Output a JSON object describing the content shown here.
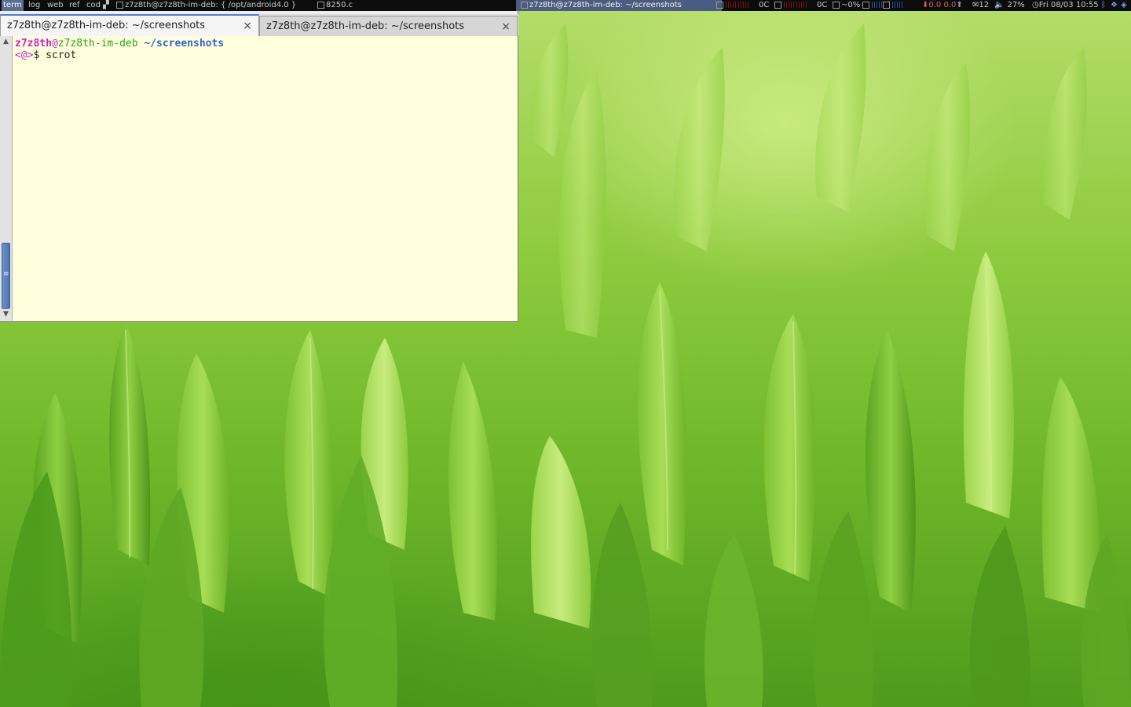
{
  "topbar": {
    "workspaces": [
      {
        "label": "term",
        "active": true
      },
      {
        "label": "log",
        "active": false
      },
      {
        "label": "web",
        "active": false
      },
      {
        "label": "ref",
        "active": false
      },
      {
        "label": "cod",
        "active": false
      }
    ],
    "window_titles": [
      "z7z8th@z7z8th-im-deb: { /opt/android4.0 }",
      "8250.c"
    ],
    "active_window_title": "z7z8th@z7z8th-im-deb: ~/screenshots",
    "cpu_temp_1": "0C",
    "cpu_temp_2": "0C",
    "cpu_percent": "~0%",
    "net_down": "0.0",
    "net_up": "0.0",
    "mail_count": "12",
    "volume": "27%",
    "datetime": "Fri 08/03 10:55"
  },
  "terminal": {
    "tabs": [
      {
        "label": "z7z8th@z7z8th-im-deb: ~/screenshots",
        "active": true
      },
      {
        "label": "z7z8th@z7z8th-im-deb: ~/screenshots",
        "active": false
      }
    ],
    "close_glyph": "×",
    "prompt": {
      "user": "z7z8th",
      "at": "@",
      "host": "z7z8th-im-deb",
      "path": "~/screenshots",
      "marker": "<@>",
      "dollar": "$",
      "command": "scrot"
    }
  },
  "colors": {
    "terminal_bg": "#ffffdd",
    "prompt_user": "#cc22cc",
    "prompt_host": "#28a028",
    "prompt_path": "#3366cc",
    "topbar_bg": "#0c0c0c",
    "active_tab_accent": "#4a7fd6"
  }
}
